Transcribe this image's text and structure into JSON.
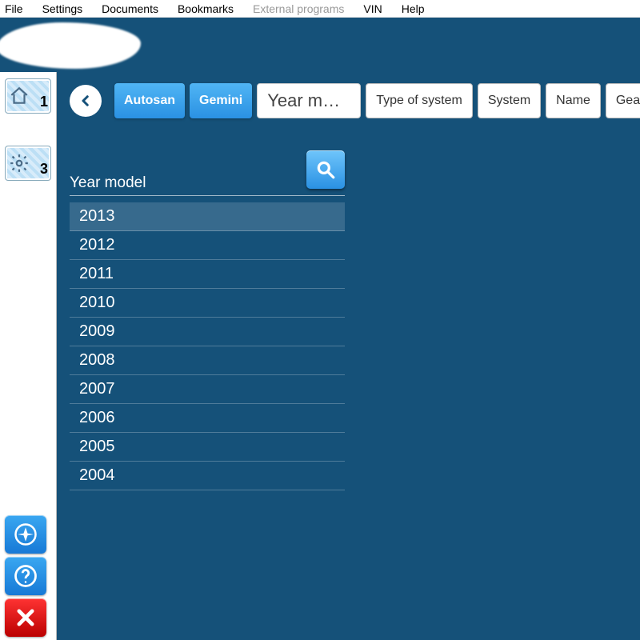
{
  "menu": {
    "items": [
      {
        "label": "File",
        "enabled": true
      },
      {
        "label": "Settings",
        "enabled": true
      },
      {
        "label": "Documents",
        "enabled": true
      },
      {
        "label": "Bookmarks",
        "enabled": true
      },
      {
        "label": "External programs",
        "enabled": false
      },
      {
        "label": "VIN",
        "enabled": true
      },
      {
        "label": "Help",
        "enabled": true
      }
    ]
  },
  "sidebar": {
    "tiles": [
      {
        "badge": "1",
        "icon": "home-icon"
      },
      {
        "badge": "3",
        "icon": "gear-icon"
      }
    ],
    "bottom_buttons": [
      {
        "name": "flight-icon",
        "color": "blue"
      },
      {
        "name": "help-icon",
        "color": "blue"
      },
      {
        "name": "close-icon",
        "color": "red"
      }
    ]
  },
  "breadcrumb": {
    "back": "‹",
    "items": [
      {
        "label": "Autosan",
        "state": "active-blue"
      },
      {
        "label": "Gemini",
        "state": "active-blue"
      },
      {
        "label": "Year m…",
        "state": "current"
      },
      {
        "label": "Type of system",
        "state": "inactive"
      },
      {
        "label": "System",
        "state": "inactive"
      },
      {
        "label": "Name",
        "state": "inactive"
      },
      {
        "label": "Gearb",
        "state": "inactive"
      }
    ]
  },
  "list": {
    "title": "Year model",
    "items": [
      {
        "label": "2013",
        "selected": true
      },
      {
        "label": "2012",
        "selected": false
      },
      {
        "label": "2011",
        "selected": false
      },
      {
        "label": "2010",
        "selected": false
      },
      {
        "label": "2009",
        "selected": false
      },
      {
        "label": "2008",
        "selected": false
      },
      {
        "label": "2007",
        "selected": false
      },
      {
        "label": "2006",
        "selected": false
      },
      {
        "label": "2005",
        "selected": false
      },
      {
        "label": "2004",
        "selected": false
      }
    ]
  }
}
